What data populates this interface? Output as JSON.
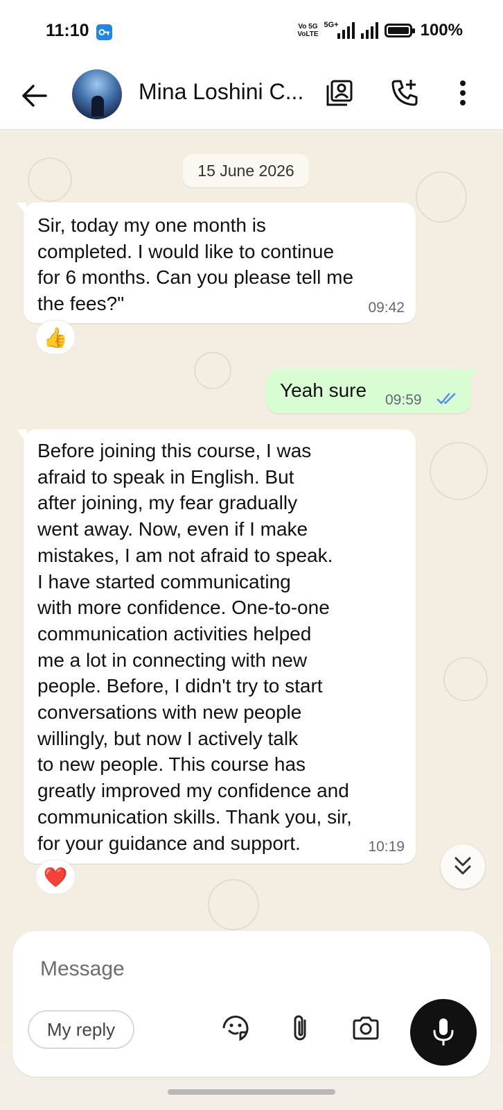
{
  "status_bar": {
    "time": "11:10",
    "network_top": "Vo 5G",
    "network_bottom": "VoLTE",
    "network_5g": "5G+",
    "battery": "100%"
  },
  "header": {
    "contact_name": "Mina Loshini C...",
    "icons": [
      "back-arrow-icon",
      "contact-card-icon",
      "add-call-icon",
      "more-vertical-icon"
    ]
  },
  "chat": {
    "date_chip": "15 June 2026",
    "messages": [
      {
        "direction": "incoming",
        "text": "Sir, today my one month is\ncompleted. I would like to continue\nfor 6 months. Can you please tell me\nthe fees?\"",
        "time": "09:42",
        "reaction": "👍"
      },
      {
        "direction": "outgoing",
        "text": "Yeah sure",
        "time": "09:59",
        "status": "read"
      },
      {
        "direction": "incoming",
        "text": "Before joining this course, I was\nafraid to speak in English. But\nafter joining, my fear gradually\nwent away. Now, even if I make\nmistakes, I am not afraid to speak.\nI have started communicating\nwith more confidence. One-to-one\ncommunication activities helped\nme a lot in connecting with new\npeople. Before, I didn't try to start\nconversations with new people\nwillingly, but now I actively talk\nto new people. This course has\ngreatly improved my confidence and\ncommunication skills. Thank you, sir,\nfor your guidance and support.",
        "time": "10:19",
        "reaction": "❤️"
      }
    ]
  },
  "composer": {
    "placeholder": "Message",
    "my_reply_label": "My reply",
    "icons": [
      "sticker-icon",
      "attach-icon",
      "camera-icon",
      "mic-icon"
    ]
  },
  "colors": {
    "outgoing_bubble": "#d9fdd3",
    "incoming_bubble": "#ffffff",
    "wallpaper": "#f3ede2",
    "read_ticks": "#4f8ef7"
  }
}
